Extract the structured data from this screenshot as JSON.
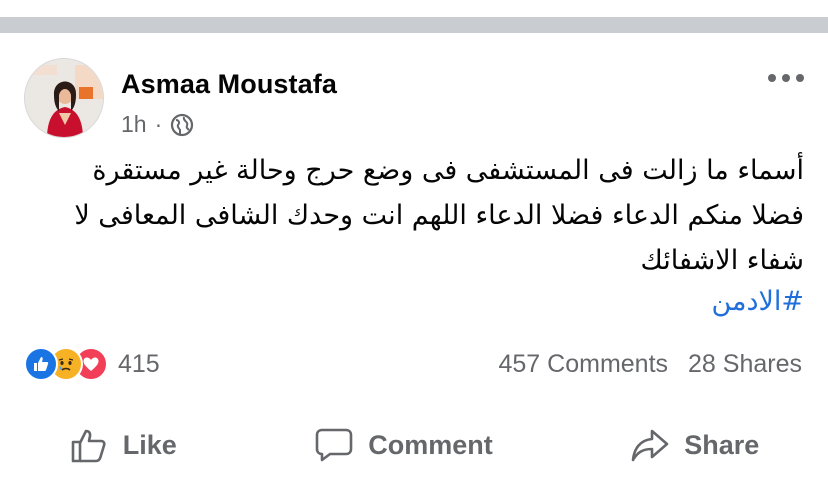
{
  "post": {
    "author": "Asmaa Moustafa",
    "time": "1h",
    "separator": "·",
    "audience_icon": "globe-icon",
    "more_icon": "more-options-icon",
    "text_lines": [
      "أسماء ما زالت فى المستشفى فى وضع حرج  وحالة غير مستقرة",
      "فضلا منكم الدعاء  فضلا الدعاء اللهم انت وحدك الشافى المعافى لا",
      "شفاء الاشفائك"
    ],
    "hashtag": "#الادمن"
  },
  "stats": {
    "reaction_icons": [
      "like-reaction-icon",
      "sad-reaction-icon",
      "love-reaction-icon"
    ],
    "reactions_count": "415",
    "comments": "457 Comments",
    "shares": "28 Shares"
  },
  "actions": {
    "like": "Like",
    "comment": "Comment",
    "share": "Share"
  },
  "colors": {
    "text": "#050505",
    "secondary": "#65676b",
    "link": "#216fdb",
    "like_blue": "#1b74e4",
    "sad_yellow": "#f7b125",
    "love_red": "#f33e58",
    "top_strip": "#c9ccd1"
  }
}
